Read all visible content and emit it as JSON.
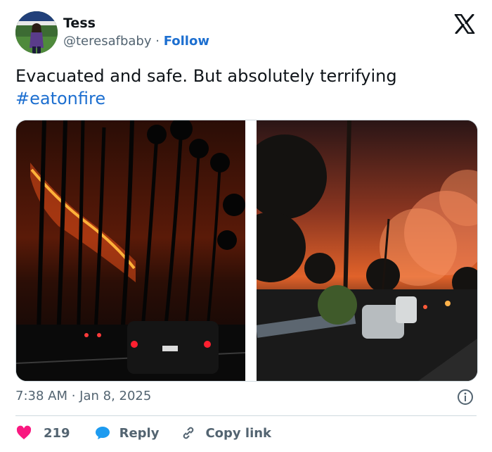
{
  "author": {
    "name": "Tess",
    "handle": "@teresafbaby",
    "separator": "·",
    "follow_label": "Follow"
  },
  "tweet": {
    "text": "Evacuated and safe. But absolutely terrifying",
    "hashtag": "#eatonfire"
  },
  "media": [
    {
      "description": "Night street with palm tree silhouettes and wildfire burning on hillside, car tail lights"
    },
    {
      "description": "Night residential street with large orange wildfire smoke glow, parked cars"
    }
  ],
  "meta": {
    "timestamp": "7:38 AM · Jan 8, 2025"
  },
  "actions": {
    "likes_count": "219",
    "reply_label": "Reply",
    "copy_link_label": "Copy link"
  },
  "colors": {
    "link": "#1d6fd0",
    "like": "#f91880",
    "muted": "#536471",
    "border": "#cfd9de"
  },
  "icons": [
    "x-logo-icon",
    "info-icon",
    "heart-icon",
    "reply-bubble-icon",
    "link-icon"
  ]
}
